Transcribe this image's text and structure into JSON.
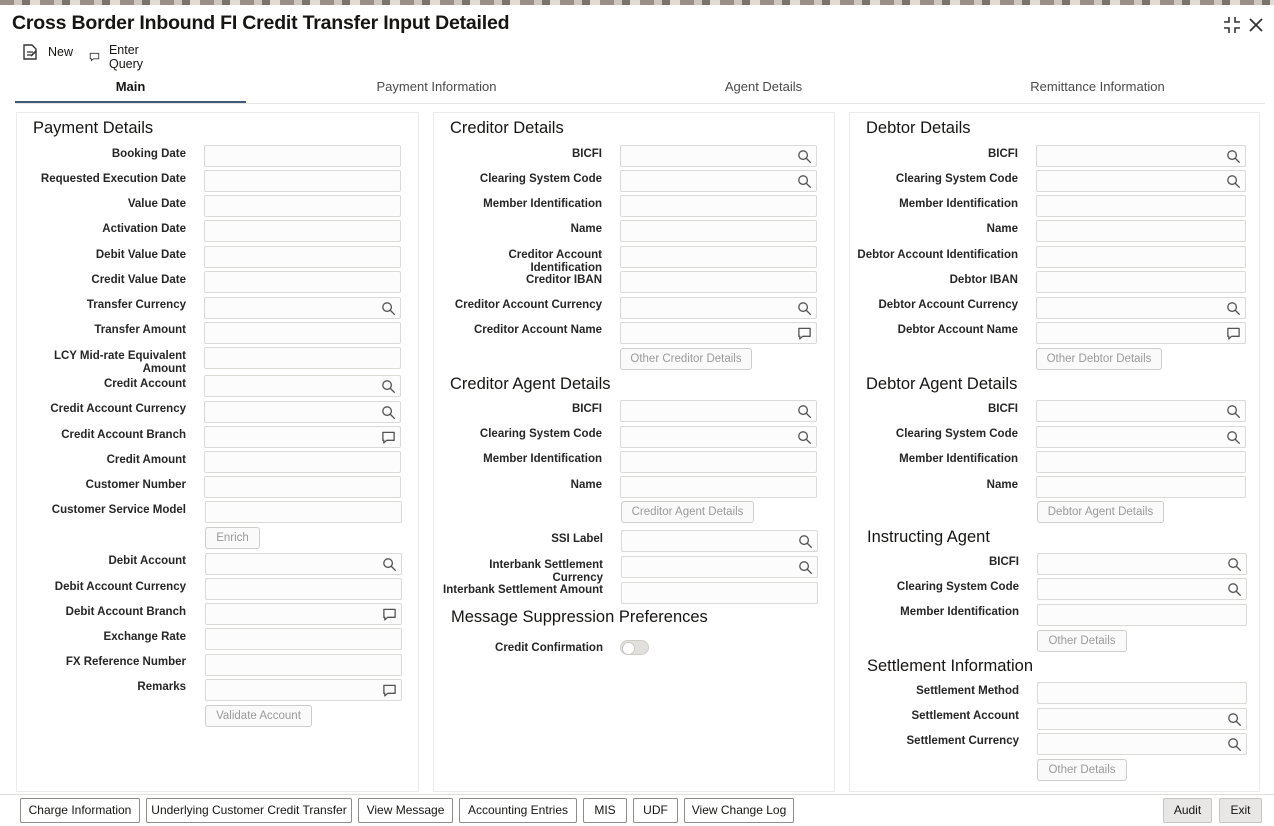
{
  "window": {
    "title": "Cross Border Inbound FI Credit Transfer Input Detailed"
  },
  "toolbar": {
    "new_label": "New",
    "enter_query_label": "Enter Query"
  },
  "tabs": [
    "Main",
    "Payment Information",
    "Agent Details",
    "Remittance Information"
  ],
  "payment_details": {
    "heading": "Payment Details",
    "labels": {
      "booking_date": "Booking Date",
      "requested_execution_date": "Requested Execution Date",
      "value_date": "Value Date",
      "activation_date": "Activation Date",
      "debit_value_date": "Debit Value Date",
      "credit_value_date": "Credit Value Date",
      "transfer_currency": "Transfer Currency",
      "transfer_amount": "Transfer Amount",
      "lcy_mid_rate_1": "LCY Mid-rate Equivalent",
      "lcy_mid_rate_2": "Amount",
      "credit_account": "Credit Account",
      "credit_account_currency": "Credit Account Currency",
      "credit_account_branch": "Credit Account Branch",
      "credit_amount": "Credit Amount",
      "customer_number": "Customer Number",
      "customer_service_model": "Customer Service Model",
      "debit_account": "Debit Account",
      "debit_account_currency": "Debit Account Currency",
      "debit_account_branch": "Debit Account Branch",
      "exchange_rate": "Exchange Rate",
      "fx_reference_number": "FX Reference Number",
      "remarks": "Remarks"
    },
    "enrich_label": "Enrich",
    "validate_account_label": "Validate Account"
  },
  "creditor_details": {
    "heading": "Creditor Details",
    "labels": {
      "bicfi": "BICFI",
      "clearing_system_code": "Clearing System Code",
      "member_identification": "Member Identification",
      "name": "Name",
      "account_identification": "Creditor Account Identification",
      "iban": "Creditor IBAN",
      "account_currency": "Creditor Account Currency",
      "account_name": "Creditor Account Name"
    },
    "other_label": "Other Creditor Details"
  },
  "creditor_agent": {
    "heading": "Creditor Agent Details",
    "labels": {
      "bicfi": "BICFI",
      "clearing_system_code": "Clearing System Code",
      "member_identification": "Member Identification",
      "name": "Name"
    },
    "button_label": "Creditor Agent Details",
    "ssi_label": "SSI Label",
    "interbank_settlement_currency": "Interbank Settlement Currency",
    "interbank_settlement_amount": "Interbank Settlement Amount"
  },
  "message_suppression": {
    "heading": "Message Suppression Preferences",
    "credit_confirmation_label": "Credit Confirmation",
    "credit_confirmation_on": false
  },
  "debtor_details": {
    "heading": "Debtor Details",
    "labels": {
      "bicfi": "BICFI",
      "clearing_system_code": "Clearing System Code",
      "member_identification": "Member Identification",
      "name": "Name",
      "account_identification": "Debtor Account Identification",
      "iban": "Debtor IBAN",
      "account_currency": "Debtor Account Currency",
      "account_name": "Debtor Account Name"
    },
    "other_label": "Other Debtor Details"
  },
  "debtor_agent": {
    "heading": "Debtor Agent Details",
    "labels": {
      "bicfi": "BICFI",
      "clearing_system_code": "Clearing System Code",
      "member_identification": "Member Identification",
      "name": "Name"
    },
    "button_label": "Debtor Agent Details"
  },
  "instructing_agent": {
    "heading": "Instructing Agent",
    "labels": {
      "bicfi": "BICFI",
      "clearing_system_code": "Clearing System Code",
      "member_identification": "Member Identification"
    },
    "other_label": "Other Details"
  },
  "settlement_information": {
    "heading": "Settlement Information",
    "labels": {
      "method": "Settlement Method",
      "account": "Settlement Account",
      "currency": "Settlement Currency"
    },
    "other_label": "Other Details"
  },
  "footer": {
    "buttons": [
      "Charge Information",
      "Underlying Customer Credit Transfer",
      "View Message",
      "Accounting Entries",
      "MIS",
      "UDF",
      "View Change Log"
    ],
    "audit_label": "Audit",
    "exit_label": "Exit"
  },
  "icons": {
    "search": "search-icon",
    "comment": "comment-icon",
    "new": "new-document-icon",
    "enter_query": "enter-query-icon",
    "minimize": "minimize-icon",
    "close": "close-icon"
  },
  "colors": {
    "active_tab_underline": "#3e5b7a",
    "input_border": "#dcdad7"
  }
}
